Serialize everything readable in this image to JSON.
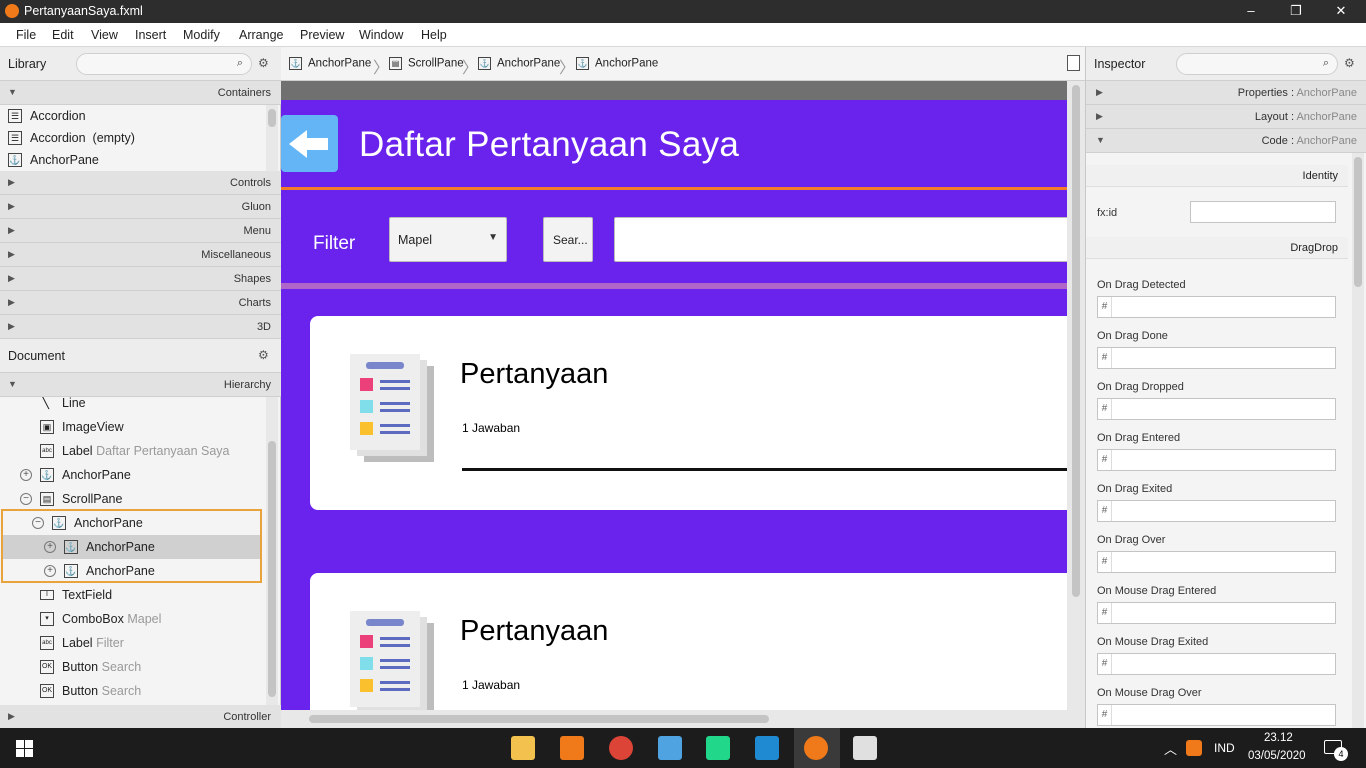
{
  "window": {
    "title": "PertanyaanSaya.fxml",
    "controls": [
      "–",
      "❐",
      "✕"
    ]
  },
  "menu": [
    "File",
    "Edit",
    "View",
    "Insert",
    "Modify",
    "Arrange",
    "Preview",
    "Window",
    "Help"
  ],
  "library": {
    "title": "Library",
    "containers_label": "Containers",
    "items": [
      "Accordion",
      "Accordion  (empty)",
      "AnchorPane"
    ],
    "sections": [
      "Controls",
      "Gluon",
      "Menu",
      "Miscellaneous",
      "Shapes",
      "Charts",
      "3D"
    ]
  },
  "document": {
    "title": "Document",
    "hierarchy_label": "Hierarchy",
    "controller_label": "Controller",
    "items": [
      {
        "type": "Line",
        "sub": ""
      },
      {
        "type": "ImageView",
        "sub": ""
      },
      {
        "type": "Label",
        "sub": "Daftar Pertanyaan Saya"
      },
      {
        "type": "AnchorPane",
        "sub": ""
      },
      {
        "type": "ScrollPane",
        "sub": ""
      },
      {
        "type": "AnchorPane",
        "sub": ""
      },
      {
        "type": "AnchorPane",
        "sub": ""
      },
      {
        "type": "AnchorPane",
        "sub": ""
      },
      {
        "type": "TextField",
        "sub": ""
      },
      {
        "type": "ComboBox",
        "sub": "Mapel"
      },
      {
        "type": "Label",
        "sub": "Filter"
      },
      {
        "type": "Button",
        "sub": "Search"
      },
      {
        "type": "Button",
        "sub": "Search"
      }
    ]
  },
  "breadcrumb": [
    "AnchorPane",
    "ScrollPane",
    "AnchorPane",
    "AnchorPane"
  ],
  "preview": {
    "title": "Daftar Pertanyaan Saya",
    "filter_label": "Filter",
    "combo_value": "Mapel",
    "search_button": "Sear...",
    "cards": [
      {
        "question": "Pertanyaan",
        "answers": "1 Jawaban"
      },
      {
        "question": "Pertanyaan",
        "answers": "1 Jawaban"
      }
    ]
  },
  "inspector": {
    "title": "Inspector",
    "sections": [
      {
        "name": "Properties",
        "target": "AnchorPane"
      },
      {
        "name": "Layout",
        "target": "AnchorPane"
      },
      {
        "name": "Code",
        "target": "AnchorPane"
      }
    ],
    "identity_label": "Identity",
    "fxid_label": "fx:id",
    "dragdrop_label": "DragDrop",
    "hash": "#",
    "events": [
      "On Drag Detected",
      "On Drag Done",
      "On Drag Dropped",
      "On Drag Entered",
      "On Drag Exited",
      "On Drag Over",
      "On Mouse Drag Entered",
      "On Mouse Drag Exited",
      "On Mouse Drag Over"
    ]
  },
  "taskbar": {
    "lang": "IND",
    "time": "23.12",
    "date": "03/05/2020",
    "notif": "4"
  },
  "colors": {
    "app_bg": "#6a22ed",
    "accent_orange": "#f27c2a",
    "back_button": "#64b5f6",
    "selection_border": "#e8a33c"
  }
}
